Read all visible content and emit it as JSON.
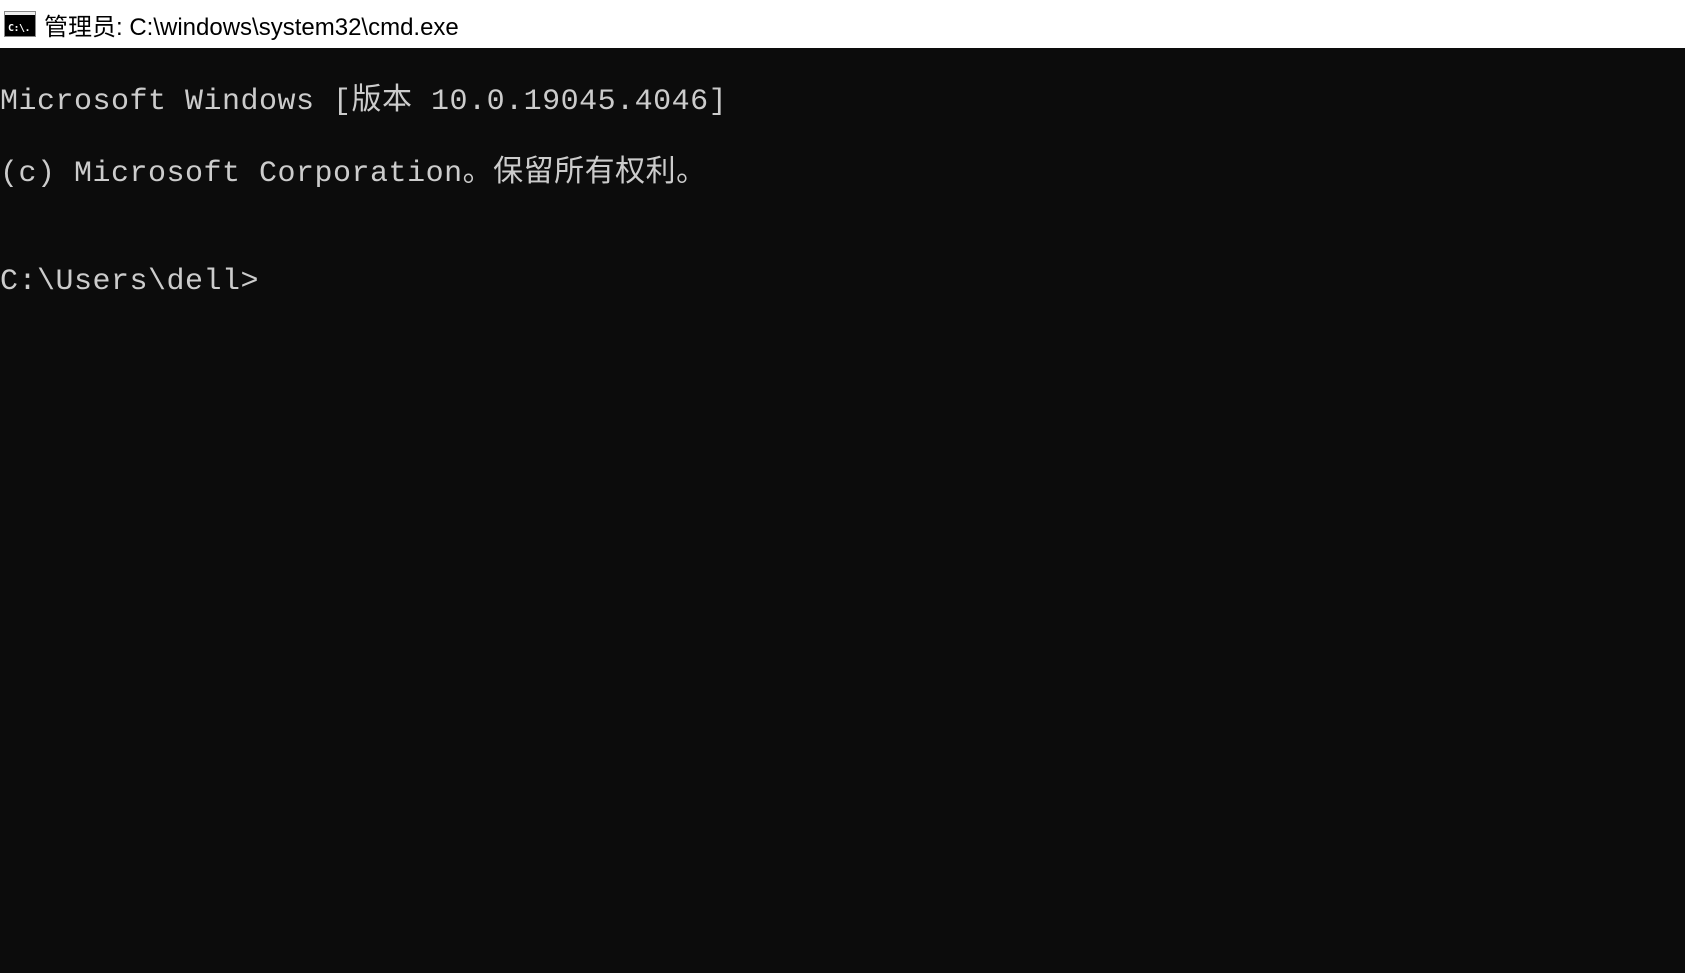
{
  "window": {
    "icon_label": "C:\\.",
    "title": "管理员: C:\\windows\\system32\\cmd.exe"
  },
  "terminal": {
    "line1": "Microsoft Windows [版本 10.0.19045.4046]",
    "line2": "(c) Microsoft Corporation。保留所有权利。",
    "blank": "",
    "prompt": "C:\\Users\\dell>",
    "input_value": ""
  }
}
